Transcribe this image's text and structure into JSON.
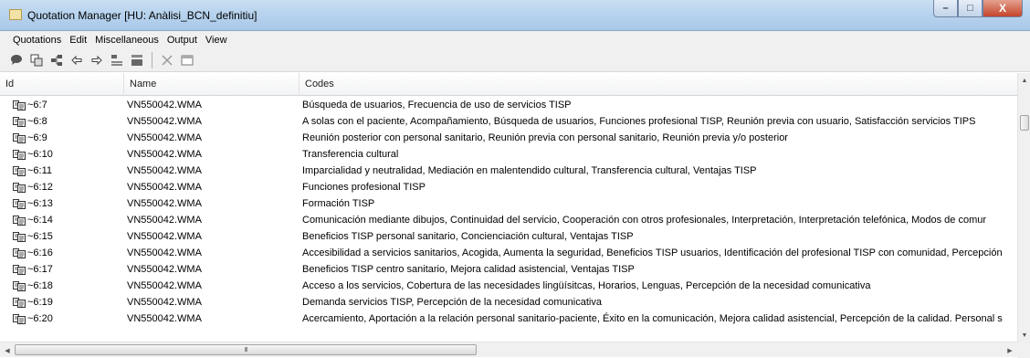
{
  "window": {
    "title": "Quotation Manager [HU: Anàlisi_BCN_definitiu]",
    "buttons": {
      "minimize": "–",
      "maximize": "□",
      "close": "X"
    }
  },
  "menu": [
    "Quotations",
    "Edit",
    "Miscellaneous",
    "Output",
    "View"
  ],
  "toolbar": {
    "icons": [
      "comment-icon",
      "copy-quotation-icon",
      "tree-icon",
      "arrow-left-icon",
      "arrow-right-icon",
      "list-icon",
      "list-alt-icon",
      "delete-icon",
      "window-icon"
    ]
  },
  "table": {
    "columns": [
      "Id",
      "Name",
      "Codes"
    ],
    "rows": [
      {
        "id": "~6:7",
        "name": "VN550042.WMA",
        "codes": "Búsqueda de usuarios, Frecuencia de uso de servicios TISP"
      },
      {
        "id": "~6:8",
        "name": "VN550042.WMA",
        "codes": "A solas con el paciente, Acompañamiento, Búsqueda de usuarios, Funciones profesional TISP, Reunión previa con usuario, Satisfacción servicios TIPS"
      },
      {
        "id": "~6:9",
        "name": "VN550042.WMA",
        "codes": "Reunión posterior con personal sanitario, Reunión previa con personal sanitario, Reunión previa y/o posterior"
      },
      {
        "id": "~6:10",
        "name": "VN550042.WMA",
        "codes": "Transferencia cultural"
      },
      {
        "id": "~6:11",
        "name": "VN550042.WMA",
        "codes": "Imparcialidad y neutralidad, Mediación en malentendido cultural, Transferencia cultural, Ventajas TISP"
      },
      {
        "id": "~6:12",
        "name": "VN550042.WMA",
        "codes": "Funciones profesional TISP"
      },
      {
        "id": "~6:13",
        "name": "VN550042.WMA",
        "codes": "Formación TISP"
      },
      {
        "id": "~6:14",
        "name": "VN550042.WMA",
        "codes": "Comunicación mediante dibujos, Continuidad del servicio, Cooperación con otros profesionales, Interpretación, Interpretación telefónica, Modos de comur"
      },
      {
        "id": "~6:15",
        "name": "VN550042.WMA",
        "codes": "Beneficios TISP personal sanitario, Concienciación cultural, Ventajas TISP"
      },
      {
        "id": "~6:16",
        "name": "VN550042.WMA",
        "codes": "Accesibilidad a servicios sanitarios, Acogida, Aumenta la seguridad, Beneficios TISP usuarios, Identificación del profesional TISP con comunidad, Percepción"
      },
      {
        "id": "~6:17",
        "name": "VN550042.WMA",
        "codes": "Beneficios TISP centro sanitario, Mejora calidad asistencial, Ventajas TISP"
      },
      {
        "id": "~6:18",
        "name": "VN550042.WMA",
        "codes": "Acceso a los servicios, Cobertura de las necesidades lingüísitcas, Horarios, Lenguas, Percepción de la necesidad comunicativa"
      },
      {
        "id": "~6:19",
        "name": "VN550042.WMA",
        "codes": "Demanda servicios TISP, Percepción de la necesidad comunicativa"
      },
      {
        "id": "~6:20",
        "name": "VN550042.WMA",
        "codes": "Acercamiento, Aportación a la relación personal sanitario-paciente, Éxito en la comunicación, Mejora calidad asistencial, Percepción de la calidad. Personal s"
      }
    ]
  },
  "scrollbars": {
    "h_thumb_grip": "III"
  }
}
